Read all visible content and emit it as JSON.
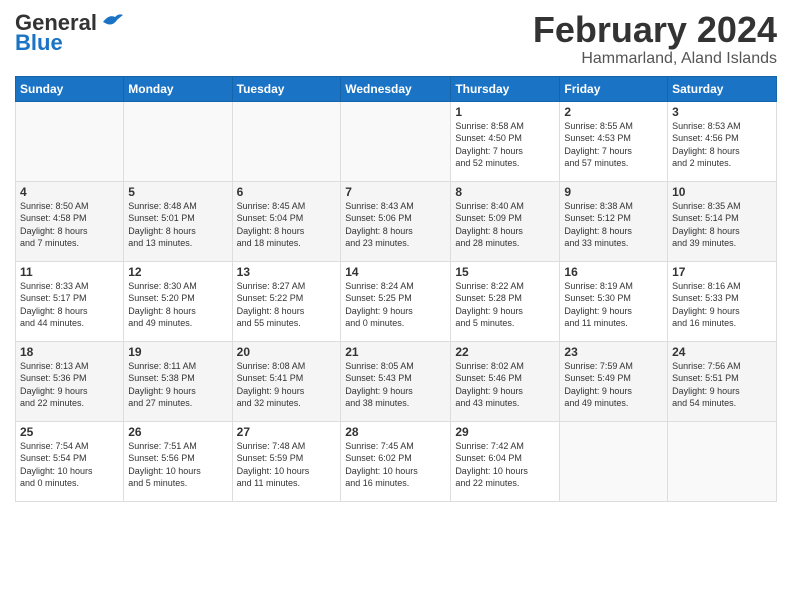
{
  "header": {
    "logo_general": "General",
    "logo_blue": "Blue",
    "month_title": "February 2024",
    "location": "Hammarland, Aland Islands"
  },
  "days_of_week": [
    "Sunday",
    "Monday",
    "Tuesday",
    "Wednesday",
    "Thursday",
    "Friday",
    "Saturday"
  ],
  "weeks": [
    [
      {
        "day": "",
        "info": ""
      },
      {
        "day": "",
        "info": ""
      },
      {
        "day": "",
        "info": ""
      },
      {
        "day": "",
        "info": ""
      },
      {
        "day": "1",
        "info": "Sunrise: 8:58 AM\nSunset: 4:50 PM\nDaylight: 7 hours\nand 52 minutes."
      },
      {
        "day": "2",
        "info": "Sunrise: 8:55 AM\nSunset: 4:53 PM\nDaylight: 7 hours\nand 57 minutes."
      },
      {
        "day": "3",
        "info": "Sunrise: 8:53 AM\nSunset: 4:56 PM\nDaylight: 8 hours\nand 2 minutes."
      }
    ],
    [
      {
        "day": "4",
        "info": "Sunrise: 8:50 AM\nSunset: 4:58 PM\nDaylight: 8 hours\nand 7 minutes."
      },
      {
        "day": "5",
        "info": "Sunrise: 8:48 AM\nSunset: 5:01 PM\nDaylight: 8 hours\nand 13 minutes."
      },
      {
        "day": "6",
        "info": "Sunrise: 8:45 AM\nSunset: 5:04 PM\nDaylight: 8 hours\nand 18 minutes."
      },
      {
        "day": "7",
        "info": "Sunrise: 8:43 AM\nSunset: 5:06 PM\nDaylight: 8 hours\nand 23 minutes."
      },
      {
        "day": "8",
        "info": "Sunrise: 8:40 AM\nSunset: 5:09 PM\nDaylight: 8 hours\nand 28 minutes."
      },
      {
        "day": "9",
        "info": "Sunrise: 8:38 AM\nSunset: 5:12 PM\nDaylight: 8 hours\nand 33 minutes."
      },
      {
        "day": "10",
        "info": "Sunrise: 8:35 AM\nSunset: 5:14 PM\nDaylight: 8 hours\nand 39 minutes."
      }
    ],
    [
      {
        "day": "11",
        "info": "Sunrise: 8:33 AM\nSunset: 5:17 PM\nDaylight: 8 hours\nand 44 minutes."
      },
      {
        "day": "12",
        "info": "Sunrise: 8:30 AM\nSunset: 5:20 PM\nDaylight: 8 hours\nand 49 minutes."
      },
      {
        "day": "13",
        "info": "Sunrise: 8:27 AM\nSunset: 5:22 PM\nDaylight: 8 hours\nand 55 minutes."
      },
      {
        "day": "14",
        "info": "Sunrise: 8:24 AM\nSunset: 5:25 PM\nDaylight: 9 hours\nand 0 minutes."
      },
      {
        "day": "15",
        "info": "Sunrise: 8:22 AM\nSunset: 5:28 PM\nDaylight: 9 hours\nand 5 minutes."
      },
      {
        "day": "16",
        "info": "Sunrise: 8:19 AM\nSunset: 5:30 PM\nDaylight: 9 hours\nand 11 minutes."
      },
      {
        "day": "17",
        "info": "Sunrise: 8:16 AM\nSunset: 5:33 PM\nDaylight: 9 hours\nand 16 minutes."
      }
    ],
    [
      {
        "day": "18",
        "info": "Sunrise: 8:13 AM\nSunset: 5:36 PM\nDaylight: 9 hours\nand 22 minutes."
      },
      {
        "day": "19",
        "info": "Sunrise: 8:11 AM\nSunset: 5:38 PM\nDaylight: 9 hours\nand 27 minutes."
      },
      {
        "day": "20",
        "info": "Sunrise: 8:08 AM\nSunset: 5:41 PM\nDaylight: 9 hours\nand 32 minutes."
      },
      {
        "day": "21",
        "info": "Sunrise: 8:05 AM\nSunset: 5:43 PM\nDaylight: 9 hours\nand 38 minutes."
      },
      {
        "day": "22",
        "info": "Sunrise: 8:02 AM\nSunset: 5:46 PM\nDaylight: 9 hours\nand 43 minutes."
      },
      {
        "day": "23",
        "info": "Sunrise: 7:59 AM\nSunset: 5:49 PM\nDaylight: 9 hours\nand 49 minutes."
      },
      {
        "day": "24",
        "info": "Sunrise: 7:56 AM\nSunset: 5:51 PM\nDaylight: 9 hours\nand 54 minutes."
      }
    ],
    [
      {
        "day": "25",
        "info": "Sunrise: 7:54 AM\nSunset: 5:54 PM\nDaylight: 10 hours\nand 0 minutes."
      },
      {
        "day": "26",
        "info": "Sunrise: 7:51 AM\nSunset: 5:56 PM\nDaylight: 10 hours\nand 5 minutes."
      },
      {
        "day": "27",
        "info": "Sunrise: 7:48 AM\nSunset: 5:59 PM\nDaylight: 10 hours\nand 11 minutes."
      },
      {
        "day": "28",
        "info": "Sunrise: 7:45 AM\nSunset: 6:02 PM\nDaylight: 10 hours\nand 16 minutes."
      },
      {
        "day": "29",
        "info": "Sunrise: 7:42 AM\nSunset: 6:04 PM\nDaylight: 10 hours\nand 22 minutes."
      },
      {
        "day": "",
        "info": ""
      },
      {
        "day": "",
        "info": ""
      }
    ]
  ]
}
